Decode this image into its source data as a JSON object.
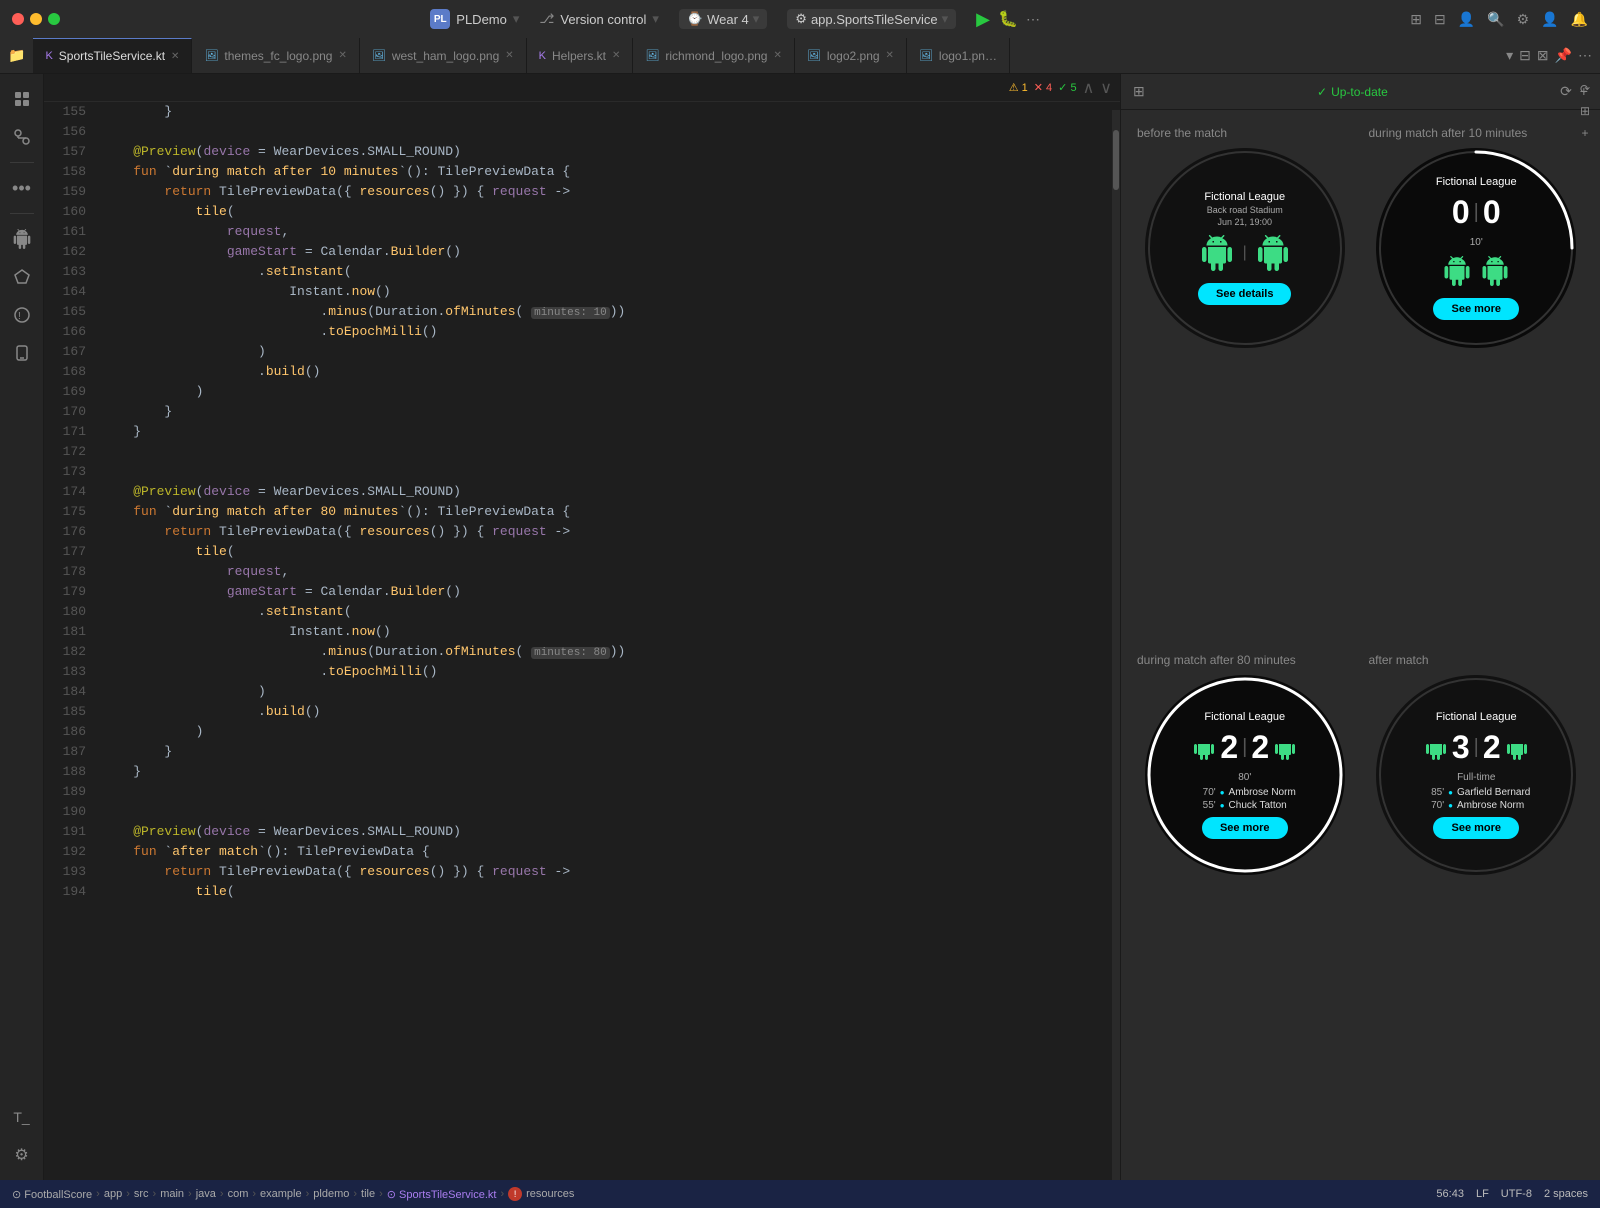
{
  "titleBar": {
    "trafficLights": [
      "red",
      "yellow",
      "green"
    ],
    "projectIcon": "PL",
    "projectName": "PLDemo",
    "versionControl": "Version control",
    "device": "Wear 4",
    "service": "app.SportsTileService",
    "icons": [
      "run",
      "debug",
      "more"
    ]
  },
  "tabs": {
    "items": [
      {
        "label": "SportsTileService.kt",
        "type": "kt",
        "active": true
      },
      {
        "label": "themes_fc_logo.png",
        "type": "png",
        "active": false
      },
      {
        "label": "west_ham_logo.png",
        "type": "png",
        "active": false
      },
      {
        "label": "Helpers.kt",
        "type": "kt",
        "active": false
      },
      {
        "label": "richmond_logo.png",
        "type": "png",
        "active": false
      },
      {
        "label": "logo2.png",
        "type": "png",
        "active": false
      },
      {
        "label": "logo1.pn…",
        "type": "png",
        "active": false
      }
    ]
  },
  "codeEditor": {
    "warnings": {
      "yellow": 1,
      "red": 4,
      "green": 5
    },
    "lineNumbers": [
      155,
      156,
      157,
      158,
      159,
      160,
      161,
      162,
      163,
      164,
      165,
      166,
      167,
      168,
      169,
      170,
      171,
      172,
      173,
      174,
      175,
      176,
      177,
      178,
      179,
      180,
      181,
      182,
      183,
      184,
      185,
      186,
      187,
      188,
      189,
      190,
      191,
      192,
      193,
      194
    ]
  },
  "preview": {
    "upToDate": "Up-to-date",
    "panels": [
      {
        "label": "before the match",
        "type": "before_match",
        "leagueName": "Fictional League",
        "stadiumName": "Back road Stadium",
        "date": "Jun 21, 19:00",
        "buttonLabel": "See details"
      },
      {
        "label": "during match after 10 minutes",
        "type": "during_10",
        "leagueName": "Fictional League",
        "score1": "0",
        "score2": "0",
        "time": "10'",
        "buttonLabel": "See more"
      },
      {
        "label": "during match after 80 minutes",
        "type": "during_80",
        "leagueName": "Fictional League",
        "score1": "2",
        "score2": "2",
        "time": "80'",
        "scorers": [
          {
            "min": "70'",
            "name": "Ambrose Norm"
          },
          {
            "min": "55'",
            "name": "Chuck Tatton"
          }
        ],
        "buttonLabel": "See more"
      },
      {
        "label": "after match",
        "type": "after_match",
        "leagueName": "Fictional League",
        "score1": "3",
        "score2": "2",
        "time": "Full-time",
        "scorers": [
          {
            "min": "85'",
            "name": "Garfield Bernard"
          },
          {
            "min": "70'",
            "name": "Ambrose Norm"
          }
        ],
        "buttonLabel": "See more"
      }
    ]
  },
  "statusBar": {
    "breadcrumb": [
      "FootballScore",
      "app",
      "src",
      "main",
      "java",
      "com",
      "example",
      "pldemo",
      "tile",
      "SportsTileService.kt",
      "resources"
    ],
    "position": "56:43",
    "lineEnding": "LF",
    "encoding": "UTF-8",
    "indent": "2 spaces"
  }
}
